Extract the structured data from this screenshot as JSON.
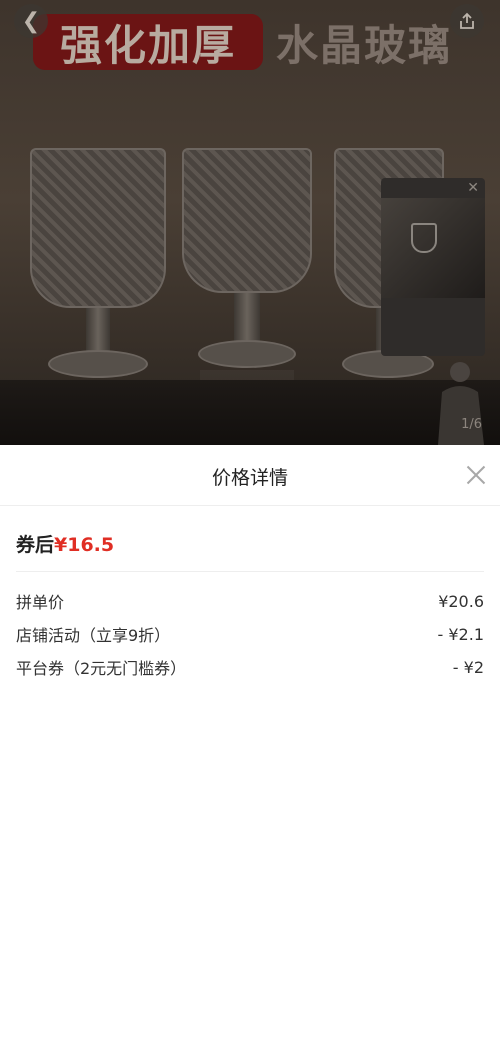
{
  "hero": {
    "banner_red": "强化加厚",
    "banner_text": "水晶玻璃",
    "page_indicator": "1/6"
  },
  "sheet": {
    "title": "价格详情",
    "after_coupon_label": "券后",
    "after_coupon_price": "¥16.5",
    "rows": [
      {
        "label": "拼单价",
        "value": "¥20.6"
      },
      {
        "label": "店铺活动（立享9折）",
        "value": "- ¥2.1"
      },
      {
        "label": "平台券（2元无门槛券）",
        "value": "- ¥2"
      }
    ]
  },
  "colors": {
    "accent_red": "#e02e24",
    "text": "#333333"
  }
}
